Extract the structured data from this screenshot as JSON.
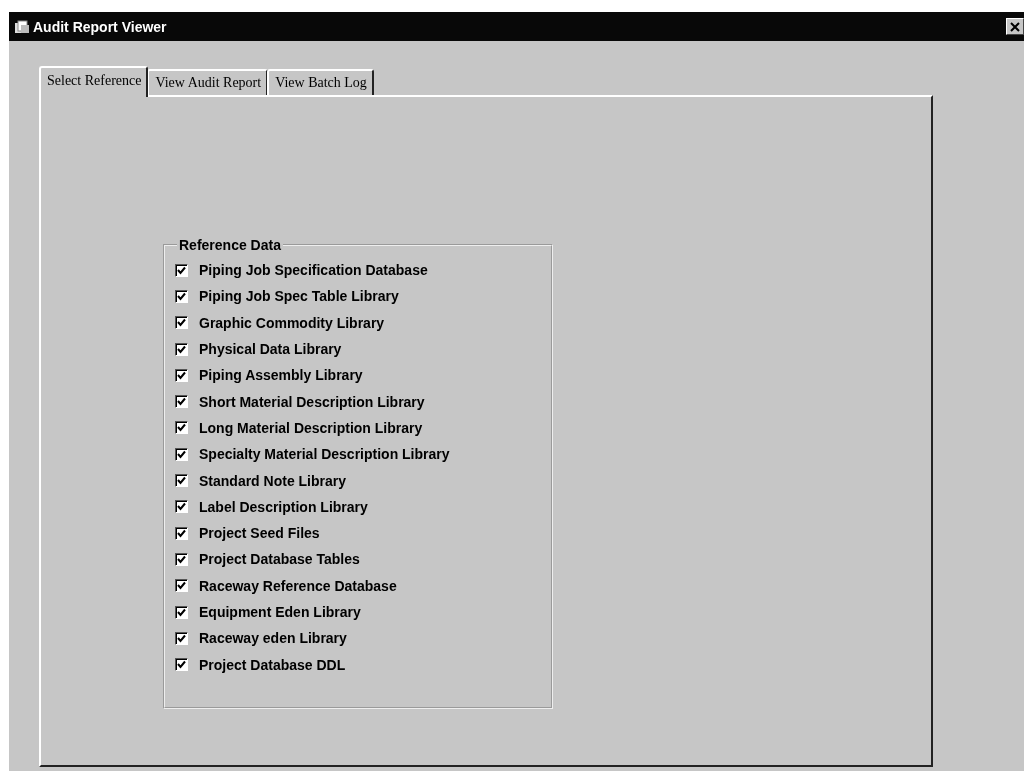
{
  "window": {
    "title": "Audit Report Viewer"
  },
  "tabs": [
    {
      "label": "Select Reference",
      "selected": true
    },
    {
      "label": "View Audit Report",
      "selected": false
    },
    {
      "label": "View Batch Log",
      "selected": false
    }
  ],
  "group": {
    "title": "Reference Data",
    "items": [
      {
        "label": "Piping Job Specification Database",
        "checked": true
      },
      {
        "label": "Piping Job Spec Table Library",
        "checked": true
      },
      {
        "label": "Graphic Commodity Library",
        "checked": true
      },
      {
        "label": "Physical Data Library",
        "checked": true
      },
      {
        "label": "Piping Assembly Library",
        "checked": true
      },
      {
        "label": "Short Material Description Library",
        "checked": true
      },
      {
        "label": "Long Material Description Library",
        "checked": true
      },
      {
        "label": "Specialty Material Description Library",
        "checked": true
      },
      {
        "label": "Standard Note Library",
        "checked": true
      },
      {
        "label": "Label Description Library",
        "checked": true
      },
      {
        "label": "Project Seed Files",
        "checked": true
      },
      {
        "label": "Project Database Tables",
        "checked": true
      },
      {
        "label": "Raceway Reference Database",
        "checked": true
      },
      {
        "label": "Equipment Eden Library",
        "checked": true
      },
      {
        "label": "Raceway eden Library",
        "checked": true
      },
      {
        "label": "Project Database DDL",
        "checked": true
      }
    ]
  }
}
